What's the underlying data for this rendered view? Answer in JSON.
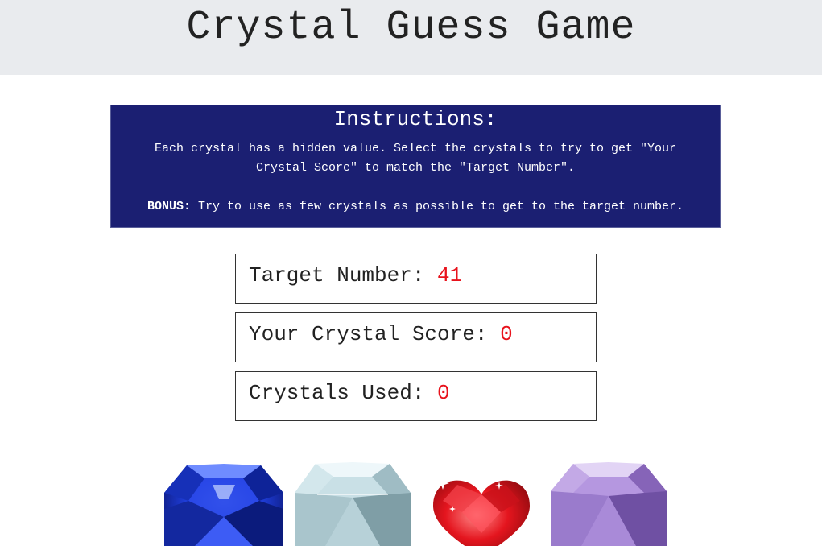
{
  "header": {
    "title": "Crystal Guess Game"
  },
  "instructions": {
    "title": "Instructions:",
    "text": "Each crystal has a hidden value. Select the crystals to try to get \"Your Crystal Score\" to match the \"Target Number\".",
    "bonus_label": "BONUS:",
    "bonus_text": " Try to use as few crystals as possible to get to the target number."
  },
  "stats": {
    "target_label": "Target Number: ",
    "target_value": "41",
    "score_label": "Your Crystal Score: ",
    "score_value": "0",
    "used_label": "Crystals Used: ",
    "used_value": "0"
  },
  "crystals": [
    {
      "name": "blue-crystal",
      "color": "#1a2fd0"
    },
    {
      "name": "clear-crystal",
      "color": "#b9d6dd"
    },
    {
      "name": "red-heart-crystal",
      "color": "#e01c24"
    },
    {
      "name": "purple-crystal",
      "color": "#a684d6"
    }
  ]
}
